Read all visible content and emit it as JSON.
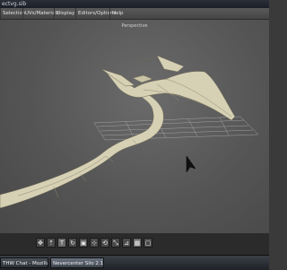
{
  "window": {
    "title": "ectvg.sib"
  },
  "menubar": {
    "items": [
      {
        "label": "Selection"
      },
      {
        "label": "UVs/Materials"
      },
      {
        "label": "Display"
      },
      {
        "label": "Editors/Options"
      },
      {
        "label": "Help"
      }
    ]
  },
  "viewport": {
    "label": "Perspective"
  },
  "toolbar": {
    "tools": [
      {
        "icon": "hand-icon",
        "glyph": "✥"
      },
      {
        "icon": "select-icon",
        "glyph": "⇡"
      },
      {
        "icon": "text-icon",
        "glyph": "T"
      },
      {
        "icon": "rotate-icon",
        "glyph": "↻"
      },
      {
        "icon": "cube-icon",
        "glyph": "▣"
      },
      {
        "icon": "axis-move-icon",
        "glyph": "⊹"
      },
      {
        "icon": "axis-rotate-icon",
        "glyph": "⟲"
      },
      {
        "icon": "axis-scale-icon",
        "glyph": "⤡"
      },
      {
        "icon": "component-icon",
        "glyph": "⊿"
      },
      {
        "icon": "grid-icon",
        "glyph": "▦"
      },
      {
        "icon": "frame-icon",
        "glyph": "▢"
      }
    ]
  },
  "taskbar": {
    "items": [
      {
        "label": "THW Chat - Mozilla ..."
      },
      {
        "label": "Nevercenter Silo 2.1 ..."
      }
    ]
  },
  "colors": {
    "model": "#d6d0b4",
    "model_shadow": "#a9a286",
    "grid": "#b8b8b8",
    "menubar": "#4f4f4f",
    "toolbar": "#2b2b2b"
  }
}
